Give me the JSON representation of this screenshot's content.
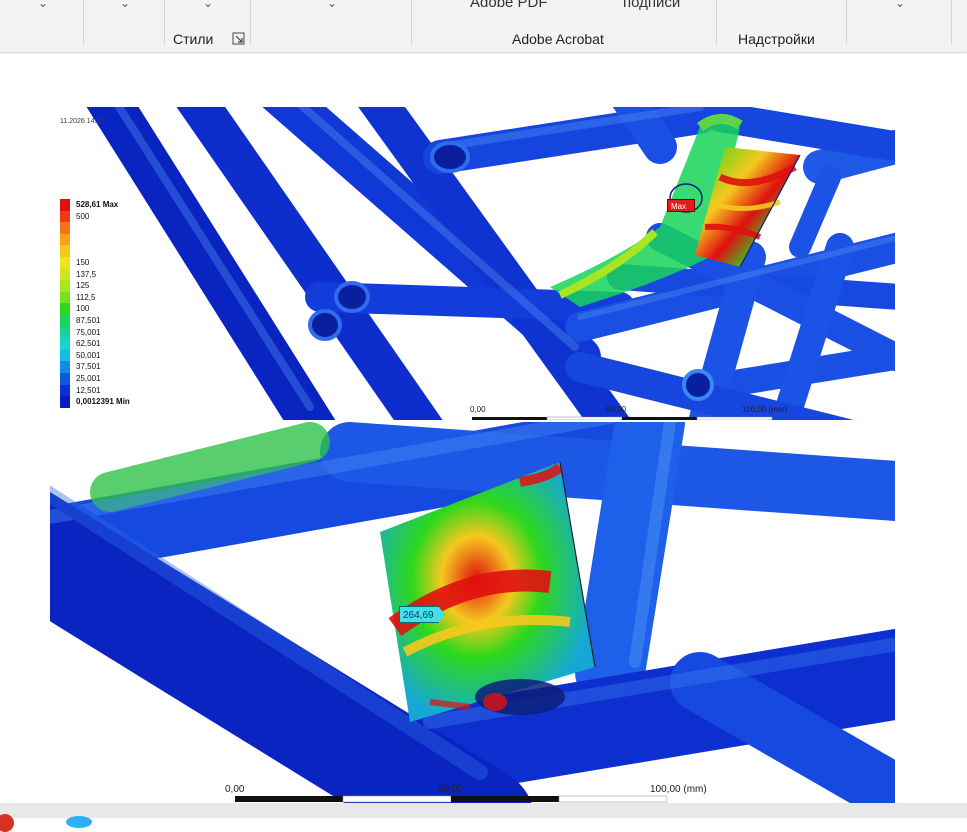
{
  "ribbon": {
    "top_items": [
      "Adobe PDF",
      "подписи"
    ],
    "groups": [
      {
        "label": "Стили"
      },
      {
        "label": "Adobe Acrobat"
      },
      {
        "label": "Надстройки"
      }
    ]
  },
  "figure_top": {
    "header_lines": [
      "",
      "",
      "",
      "",
      "",
      "",
      "",
      "11.2026 14:32"
    ],
    "legend": [
      {
        "label": "528,61 Max",
        "color": "#e01010",
        "bold": true
      },
      {
        "label": "500",
        "color": "#f03a10"
      },
      {
        "label": "",
        "color": "#f37515"
      },
      {
        "label": "",
        "color": "#f7a21a"
      },
      {
        "label": "",
        "color": "#f5c81e"
      },
      {
        "label": "150",
        "color": "#e9e61f"
      },
      {
        "label": "137,5",
        "color": "#cfe620"
      },
      {
        "label": "125",
        "color": "#a8e61f"
      },
      {
        "label": "112,5",
        "color": "#72e21d"
      },
      {
        "label": "100",
        "color": "#2ed81b"
      },
      {
        "label": "87,501",
        "color": "#17d45a"
      },
      {
        "label": "75,001",
        "color": "#16d49c"
      },
      {
        "label": "62,501",
        "color": "#16d4cf"
      },
      {
        "label": "50,001",
        "color": "#14bde8"
      },
      {
        "label": "37,501",
        "color": "#128ae6"
      },
      {
        "label": "25,001",
        "color": "#0f58e0"
      },
      {
        "label": "12,501",
        "color": "#0b2fd6"
      },
      {
        "label": "0,0012391 Min",
        "color": "#071cc4",
        "bold": true
      }
    ],
    "max_tag": "Max",
    "scale": [
      "0,00",
      "50,00",
      "100,00 (mm)"
    ]
  },
  "figure_bottom": {
    "probe_value": "264,69",
    "scale": [
      "0,00",
      "50,00",
      "100,00 (mm)"
    ]
  },
  "colors": {
    "tube_dark": "#0b2fd6",
    "tube_mid": "#1a52e6",
    "tube_light": "#2c7df0",
    "stress_high": "#e01010",
    "stress_mid": "#2ed81b",
    "stress_warm": "#f5c81e"
  }
}
